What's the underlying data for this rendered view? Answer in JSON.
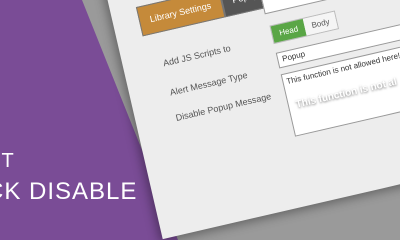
{
  "brand": {
    "line1": "HT",
    "line2": "CK DISABLE"
  },
  "tabs": [
    {
      "label": "Library Settings"
    },
    {
      "label": "Popup Se"
    }
  ],
  "settings": {
    "add_js_label": "Add JS Scripts to",
    "head_option": "Head",
    "body_option": "Body",
    "alert_label": "Alert Message Type",
    "alert_value": "Popup",
    "disable_label": "Disable Popup Message",
    "disable_text": "This function is not allowed here!!"
  },
  "overlay": {
    "text": "This function is not al"
  },
  "colors": {
    "brand_purple": "#7a4c96",
    "active_tab": "#c58a3a",
    "head_toggle": "#5aa646"
  },
  "icons": [
    "dropdown-caret-icon"
  ]
}
